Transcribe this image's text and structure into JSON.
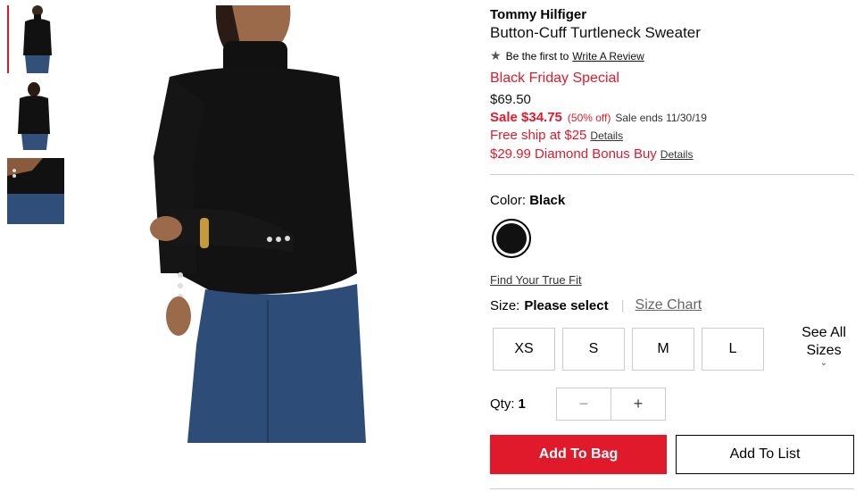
{
  "thumbnails": [
    {
      "name": "front view",
      "active": true
    },
    {
      "name": "back view",
      "active": false
    },
    {
      "name": "cuff detail",
      "active": false
    }
  ],
  "product": {
    "brand": "Tommy Hilfiger",
    "name": "Button-Cuff Turtleneck Sweater",
    "review_prefix": "Be the first to",
    "review_link": "Write A Review",
    "star_icon": "star-icon",
    "promo": "Black Friday Special",
    "original_price": "$69.50",
    "sale_price": "Sale $34.75",
    "discount": "(50% off)",
    "sale_ends": "Sale ends 11/30/19",
    "ship_text": "Free ship at $25",
    "bonus_text": "$29.99 Diamond Bonus Buy",
    "details_label": "Details"
  },
  "color": {
    "label": "Color:",
    "value": "Black",
    "swatch_hex": "#111111"
  },
  "fit": {
    "true_fit": "Find Your True Fit"
  },
  "size": {
    "label": "Size:",
    "value": "Please select",
    "chart_link": "Size Chart",
    "options": [
      "XS",
      "S",
      "M",
      "L"
    ],
    "see_all": "See All Sizes"
  },
  "qty": {
    "label": "Qty:",
    "value": "1",
    "minus": "−",
    "plus": "+"
  },
  "actions": {
    "add_to_bag": "Add To Bag",
    "add_to_list": "Add To List"
  },
  "colors": {
    "accent": "#e11a2b",
    "border": "#cccccc"
  }
}
